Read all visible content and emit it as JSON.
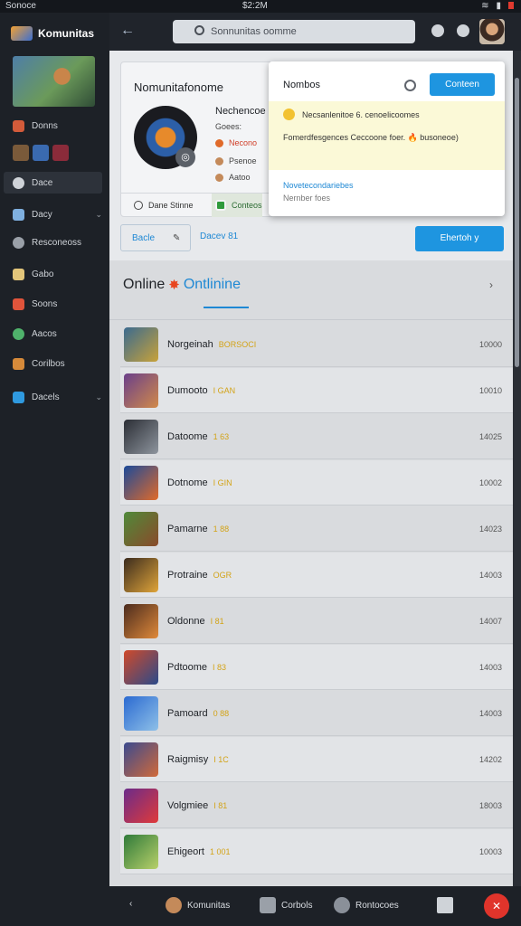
{
  "status_bar": {
    "left": "Sonoce",
    "time": "$2:2M"
  },
  "sidebar": {
    "brand": "Komunitas",
    "items": [
      {
        "label": "Donns",
        "icon": "people-icon",
        "color": "#d35b3a"
      },
      {
        "label": "Dace",
        "icon": "disc-icon",
        "color": "#cfd3d8"
      },
      {
        "label": "Dacy",
        "icon": "image-icon",
        "color": "#7fb0e0"
      },
      {
        "label": "Resconeoss",
        "icon": "gamepad-icon",
        "color": "#9aa0a8"
      },
      {
        "label": "Gabo",
        "icon": "sword-icon",
        "color": "#e3c67a"
      },
      {
        "label": "Soons",
        "icon": "controller-icon",
        "color": "#e0543b"
      },
      {
        "label": "Aacos",
        "icon": "globe-icon",
        "color": "#4fb26b"
      },
      {
        "label": "Corilbos",
        "icon": "box-icon",
        "color": "#d68a3a"
      },
      {
        "label": "Dacels",
        "icon": "chart-icon",
        "color": "#2f9ae0"
      }
    ]
  },
  "topbar": {
    "search_placeholder": "Sonnunitas oomme"
  },
  "profile": {
    "title": "Nomunitafonome",
    "name": "Nechencoe",
    "subtitle": "Goees:",
    "row1": "Necono",
    "row2": "Psenoe",
    "row3": "Aatoo",
    "foot1": "Dane Stinne",
    "foot2": "Conteos"
  },
  "notification": {
    "title": "Nombos",
    "button": "Conteen",
    "message1": "Necsanlenitoe 6. cenoelicoomes",
    "message2": "Fomerdfesgences Ceccoone foer. 🔥 busoneoe)",
    "link": "Novetecondariebes",
    "sub": "Nernber foes"
  },
  "filters": {
    "f1": "Bacle",
    "f2": "Dacev 81",
    "primary": "Ehertoh y"
  },
  "list": {
    "heading": "Online",
    "tab": "Ontlinine",
    "rows": [
      {
        "name": "Norgeinah",
        "tag": "BORSOCI",
        "num": "10000",
        "c1": "#3a6a8f",
        "c2": "#c8a23a"
      },
      {
        "name": "Dumooto",
        "tag": "I GAN",
        "num": "10010",
        "c1": "#6a3f8a",
        "c2": "#d18a4a"
      },
      {
        "name": "Datoome",
        "tag": "1 63",
        "num": "14025",
        "c1": "#2b2e35",
        "c2": "#8e959e"
      },
      {
        "name": "Dotnome",
        "tag": "I GIN",
        "num": "10002",
        "c1": "#1b4a9a",
        "c2": "#e06a2a"
      },
      {
        "name": "Pamarne",
        "tag": "1 88",
        "num": "14023",
        "c1": "#4f8a3a",
        "c2": "#8a4a2a"
      },
      {
        "name": "Protraine",
        "tag": "OGR",
        "num": "14003",
        "c1": "#3a2b1e",
        "c2": "#e0a53a"
      },
      {
        "name": "Oldonne",
        "tag": "I 81",
        "num": "14007",
        "c1": "#4a2b1e",
        "c2": "#e08a3a"
      },
      {
        "name": "Pdtoome",
        "tag": "I 83",
        "num": "14003",
        "c1": "#d14a2a",
        "c2": "#2a4a8a"
      },
      {
        "name": "Pamoard",
        "tag": "0 88",
        "num": "14003",
        "c1": "#2b6ad1",
        "c2": "#8ec0e8"
      },
      {
        "name": "Raigmisy",
        "tag": "I 1C",
        "num": "14202",
        "c1": "#3a4a8f",
        "c2": "#d16a3a"
      },
      {
        "name": "Volgmiee",
        "tag": "I 81",
        "num": "18003",
        "c1": "#6a2b8a",
        "c2": "#e03a3a"
      },
      {
        "name": "Ehigeort",
        "tag": "1 001",
        "num": "10003",
        "c1": "#2f7a3a",
        "c2": "#b8d06a"
      }
    ]
  },
  "bottom_bar": {
    "b1": "Komunitas",
    "b2": "Corbols",
    "b3": "Rontocoes"
  }
}
